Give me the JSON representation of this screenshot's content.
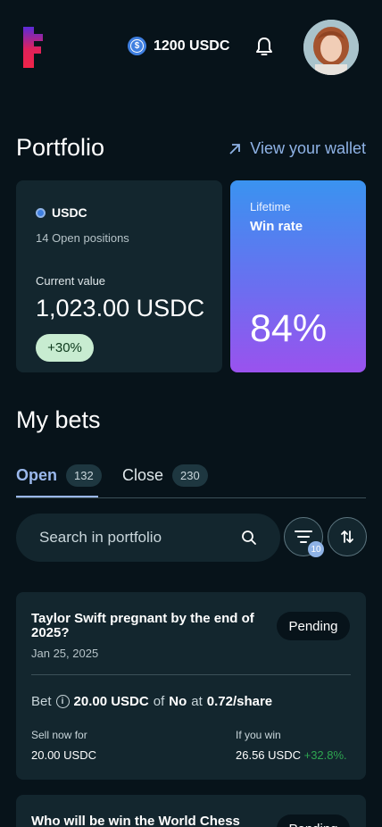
{
  "header": {
    "balance": "1200 USDC"
  },
  "portfolio": {
    "title": "Portfolio",
    "wallet_link": "View your wallet",
    "usdc_card": {
      "currency": "USDC",
      "open_positions": "14 Open positions",
      "current_value_label": "Current value",
      "current_value": "1,023.00 USDC",
      "change": "+30%"
    },
    "win_card": {
      "line1": "Lifetime",
      "line2": "Win rate",
      "value": "84%"
    }
  },
  "bets": {
    "title": "My bets",
    "tabs": [
      {
        "label": "Open",
        "count": "132"
      },
      {
        "label": "Close",
        "count": "230"
      }
    ],
    "search_placeholder": "Search in portfolio",
    "filter_count": "10",
    "items": [
      {
        "title": "Taylor Swift pregnant by the end of 2025?",
        "date": "Jan 25, 2025",
        "status": "Pending",
        "bet_label": "Bet",
        "amount": "20.00 USDC",
        "of": "of",
        "side": "No",
        "at": "at",
        "price": "0.72/share",
        "sell_label": "Sell now for",
        "sell_value": "20.00 USDC",
        "win_label": "If you win",
        "win_value": "26.56 USDC",
        "win_pct": "+32.8%."
      },
      {
        "title": "Who will be win the World Chess",
        "status": "Pending"
      }
    ]
  },
  "colors": {
    "background": "#07131a",
    "card": "#13262e",
    "accent": "#8fb3e6",
    "positive": "#2ea550"
  },
  "icons": [
    "app-logo-icon",
    "usdc-coin-icon",
    "bell-icon",
    "arrow-up-right-icon",
    "search-icon",
    "filter-icon",
    "sort-icon",
    "info-icon"
  ]
}
